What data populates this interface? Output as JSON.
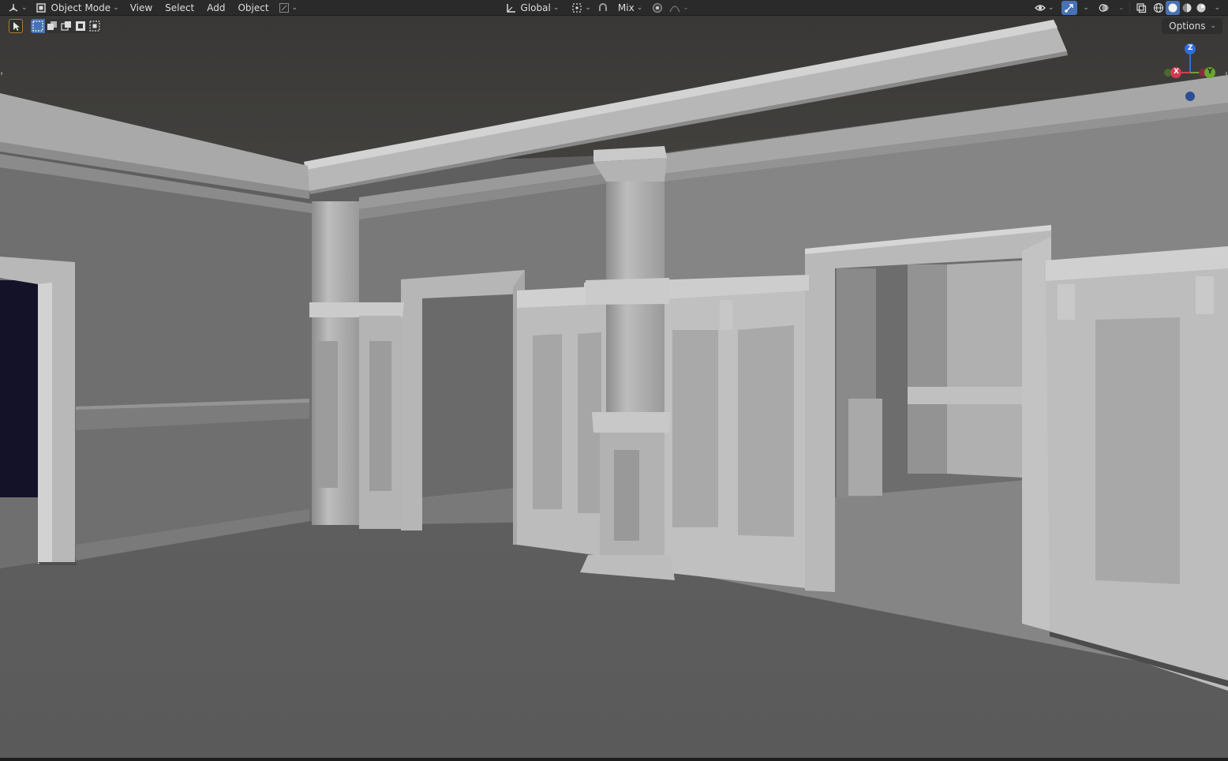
{
  "header": {
    "editor_type_icon": "3d-viewport-icon",
    "mode": {
      "icon": "object-mode-icon",
      "label": "Object Mode"
    },
    "menus": [
      "View",
      "Select",
      "Add",
      "Object"
    ],
    "transform_orientation": {
      "icon": "orientation-global-icon",
      "label": "Global"
    },
    "pivot_icon": "pivot-point-icon",
    "snap_icon": "snap-icon",
    "snap_mode": {
      "label": "Mix"
    },
    "proportional_icon": "proportional-editing-icon",
    "falloff_icon": "falloff-curve-icon",
    "right_icons": [
      "visibility-icon",
      "gizmo-toggle-icon",
      "overlay-toggle-icon",
      "xray-icon"
    ],
    "shading_modes": [
      "wireframe",
      "solid",
      "material-preview",
      "rendered"
    ],
    "active_shading": "solid"
  },
  "toolbar": {
    "tool_icon": "select-box-cursor-icon",
    "selection_modes": [
      "new",
      "extend",
      "subtract",
      "invert",
      "intersect"
    ],
    "active_selection_mode": "new"
  },
  "options": {
    "label": "Options"
  },
  "nav_gizmo": {
    "axes": [
      {
        "label": "Z",
        "color": "#2f6ed9"
      },
      {
        "label": "Y",
        "color": "#6ba430"
      },
      {
        "label": "X",
        "color": "#d33a53"
      }
    ]
  },
  "colors": {
    "header_bg": "#2a2a2a",
    "accent_blue": "#4772b3",
    "active_tool_outline": "#b07a2a",
    "ceiling": "#3c3b39",
    "wall": "#767676",
    "floor": "#5f5f5f",
    "trim": "#bdbdbd"
  }
}
